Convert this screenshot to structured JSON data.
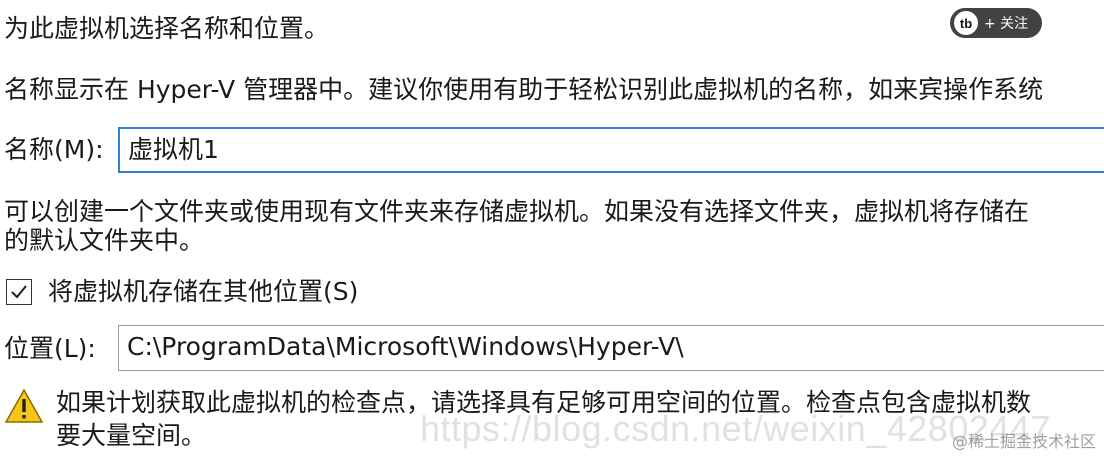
{
  "wizard": {
    "heading": "为此虚拟机选择名称和位置。",
    "name_desc": "名称显示在 Hyper-V 管理器中。建议你使用有助于轻松识别此虚拟机的名称，如来宾操作系统",
    "name_label": "名称(M):",
    "name_value": "虚拟机1",
    "folder_desc_line1": "可以创建一个文件夹或使用现有文件夹来存储虚拟机。如果没有选择文件夹，虚拟机将存储在",
    "folder_desc_line2": "的默认文件夹中。",
    "store_elsewhere_label": "将虚拟机存储在其他位置(S)",
    "store_elsewhere_checked": true,
    "location_label": "位置(L):",
    "location_value": "C:\\ProgramData\\Microsoft\\Windows\\Hyper-V\\",
    "warning_icon": "warning-icon",
    "warning_line1": "如果计划获取此虚拟机的检查点，请选择具有足够可用空间的位置。检查点包含虚拟机数",
    "warning_line2": "要大量空间。"
  },
  "overlay": {
    "follow_logo": "tb",
    "follow_label": "+ 关注",
    "watermark_url": "https://blog.csdn.net/weixin_42802447",
    "watermark_site": "@稀土掘金技术社区"
  },
  "colors": {
    "focus_border": "#2f7fd0",
    "warning_fill": "#f5c518"
  }
}
